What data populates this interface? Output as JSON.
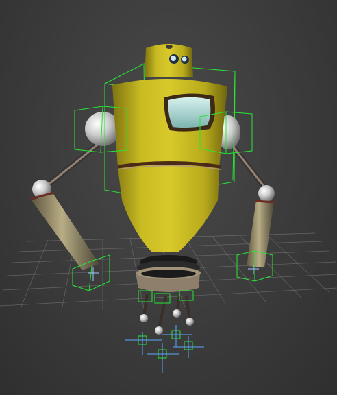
{
  "viewport": {
    "name": "3d-perspective-viewport",
    "label": "",
    "background": "#3b3b3b"
  },
  "scene": {
    "object": "robot-character-model",
    "body_color": "#c8b81e",
    "metal_color": "#8d7f6b",
    "joint_color": "#d9d9d9",
    "visor_color": "#a9d8d4",
    "selection_color": "#27e634",
    "helper_color": "#5aa8ff",
    "grid_color": "#8a8a8a"
  }
}
